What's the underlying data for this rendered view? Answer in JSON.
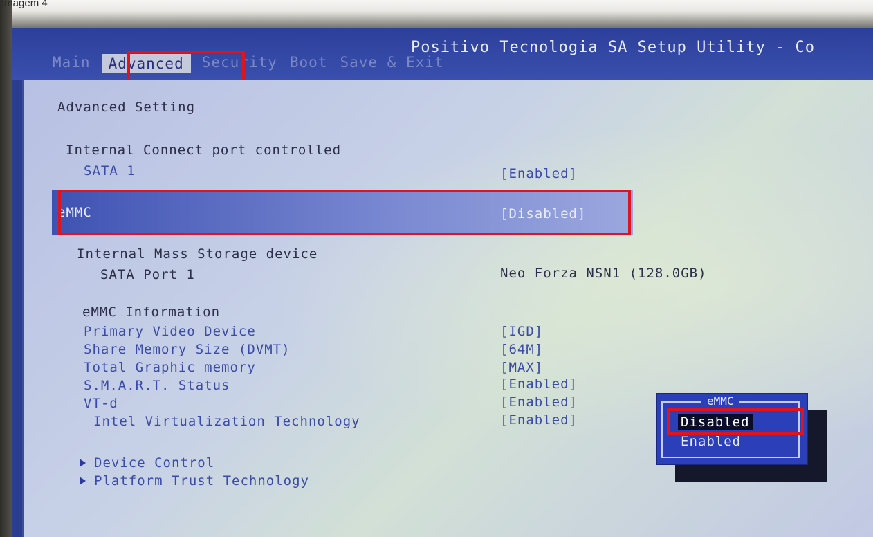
{
  "image_label": "Imagem 4",
  "header": {
    "title": "Positivo Tecnologia SA Setup Utility - Co",
    "tabs": [
      {
        "label": "Main",
        "active": false
      },
      {
        "label": "Advanced",
        "active": true
      },
      {
        "label": "Security",
        "active": false
      },
      {
        "label": "Boot",
        "active": false
      },
      {
        "label": "Save & Exit",
        "active": false
      }
    ]
  },
  "page": {
    "heading": "Advanced Setting",
    "internal_connect": "Internal Connect port controlled",
    "sata1": {
      "label": "SATA 1",
      "value": "[Enabled]"
    },
    "emmc": {
      "label": "eMMC",
      "value": "[Disabled]"
    },
    "mass_storage": "Internal Mass Storage device",
    "sata_port1": {
      "label": "SATA Port 1",
      "value": "Neo Forza NSN1 (128.0GB)"
    },
    "emmc_info": "eMMC Information",
    "settings": [
      {
        "label": "Primary Video Device",
        "value": "[IGD]"
      },
      {
        "label": "Share Memory Size (DVMT)",
        "value": "[64M]"
      },
      {
        "label": "Total Graphic memory",
        "value": "[MAX]"
      },
      {
        "label": "S.M.A.R.T. Status",
        "value": "[Enabled]"
      },
      {
        "label": "VT-d",
        "value": "[Enabled]"
      },
      {
        "label": "Intel Virtualization Technology",
        "value": "[Enabled]"
      }
    ],
    "submenus": [
      "Device Control",
      "Platform Trust Technology"
    ]
  },
  "popup": {
    "title": "eMMC",
    "options": [
      "Disabled",
      "Enabled"
    ],
    "selected": "Disabled"
  },
  "colors": {
    "highlight_box": "#e0141c",
    "screen_blue": "#2a3d8f",
    "panel": "#c4cbe4"
  }
}
